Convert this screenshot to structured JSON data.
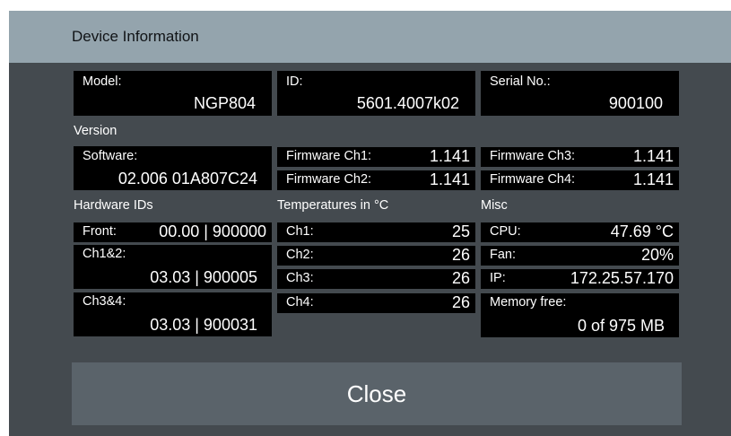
{
  "title": "Device Information",
  "model": {
    "label": "Model:",
    "value": "NGP804"
  },
  "id": {
    "label": "ID:",
    "value": "5601.4007k02"
  },
  "serial": {
    "label": "Serial No.:",
    "value": "900100"
  },
  "version": {
    "heading": "Version",
    "software": {
      "label": "Software:",
      "value": "02.006 01A807C24"
    },
    "firmware": [
      {
        "label": "Firmware Ch1:",
        "value": "1.141"
      },
      {
        "label": "Firmware Ch2:",
        "value": "1.141"
      },
      {
        "label": "Firmware Ch3:",
        "value": "1.141"
      },
      {
        "label": "Firmware Ch4:",
        "value": "1.141"
      }
    ]
  },
  "hardware": {
    "heading": "Hardware IDs",
    "front": {
      "label": "Front:",
      "value": "00.00 | 900000"
    },
    "ch12": {
      "label": "Ch1&2:",
      "value": "03.03 | 900005"
    },
    "ch34": {
      "label": "Ch3&4:",
      "value": "03.03 | 900031"
    }
  },
  "temperatures": {
    "heading": "Temperatures in °C",
    "rows": [
      {
        "label": "Ch1:",
        "value": "25"
      },
      {
        "label": "Ch2:",
        "value": "26"
      },
      {
        "label": "Ch3:",
        "value": "26"
      },
      {
        "label": "Ch4:",
        "value": "26"
      }
    ]
  },
  "misc": {
    "heading": "Misc",
    "cpu": {
      "label": "CPU:",
      "value": "47.69 °C"
    },
    "fan": {
      "label": "Fan:",
      "value": "20%"
    },
    "ip": {
      "label": "IP:",
      "value": "172.25.57.170"
    },
    "memory": {
      "label": "Memory free:",
      "value": "0 of 975 MB"
    }
  },
  "close_label": "Close"
}
